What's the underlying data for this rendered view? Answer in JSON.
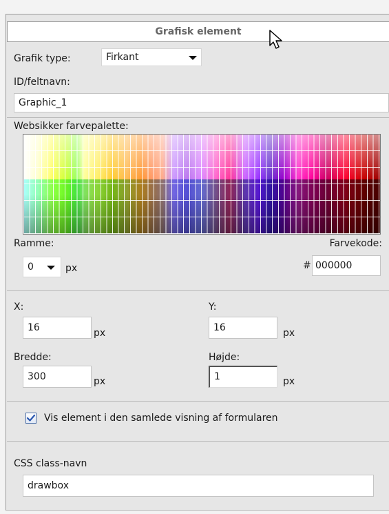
{
  "panel": {
    "title": "Grafisk element"
  },
  "grafik_type": {
    "label": "Grafik type:",
    "value": "Firkant"
  },
  "id_field": {
    "label": "ID/feltnavn:",
    "value": "Graphic_1"
  },
  "palette": {
    "label": "Websikker farvepalette:"
  },
  "ramme": {
    "label": "Ramme:",
    "value": "0",
    "unit": "px"
  },
  "farvekode": {
    "label": "Farvekode:",
    "prefix": "#",
    "value": "000000"
  },
  "position": {
    "x_label": "X:",
    "x_value": "16",
    "x_unit": "px",
    "y_label": "Y:",
    "y_value": "16",
    "y_unit": "px"
  },
  "size": {
    "width_label": "Bredde:",
    "width_value": "300",
    "width_unit": "px",
    "height_label": "Højde:",
    "height_value": "1",
    "height_unit": "px"
  },
  "visibility": {
    "checked": true,
    "label": "Vis element i den samlede visning af formularen"
  },
  "css": {
    "label": "CSS class-navn",
    "value": "drawbox"
  },
  "colors": {
    "checkbox_tick": "#2a57b0",
    "panel_bg": "#e6e6e6",
    "title_text": "#666666"
  }
}
